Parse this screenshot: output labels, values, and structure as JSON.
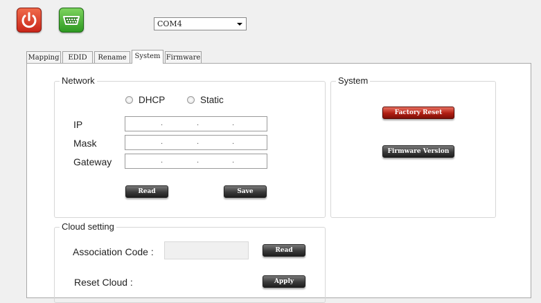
{
  "toolbar": {
    "power_icon": "power-icon",
    "serial_icon": "serial-port-icon",
    "port_select": {
      "value": "COM4"
    }
  },
  "tabs": [
    {
      "label": "Mapping",
      "active": false
    },
    {
      "label": "EDID",
      "active": false
    },
    {
      "label": "Rename",
      "active": false
    },
    {
      "label": "System",
      "active": true
    },
    {
      "label": "Firmware",
      "active": false
    }
  ],
  "network": {
    "title": "Network",
    "dhcp_label": "DHCP",
    "static_label": "Static",
    "ip_label": "IP",
    "mask_label": "Mask",
    "gateway_label": "Gateway",
    "read_label": "Read",
    "save_label": "Save"
  },
  "system": {
    "title": "System",
    "factory_reset_label": "Factory Reset",
    "firmware_version_label": "Firmware Version"
  },
  "cloud": {
    "title": "Cloud setting",
    "association_code_label": "Association Code :",
    "association_code_value": "",
    "read_label": "Read",
    "reset_cloud_label": "Reset Cloud :",
    "apply_label": "Apply"
  },
  "colors": {
    "power_button": "#d8321f",
    "serial_button": "#3fa52e",
    "factory_reset_button": "#b01e12",
    "dark_button": "#3a3a3a"
  }
}
